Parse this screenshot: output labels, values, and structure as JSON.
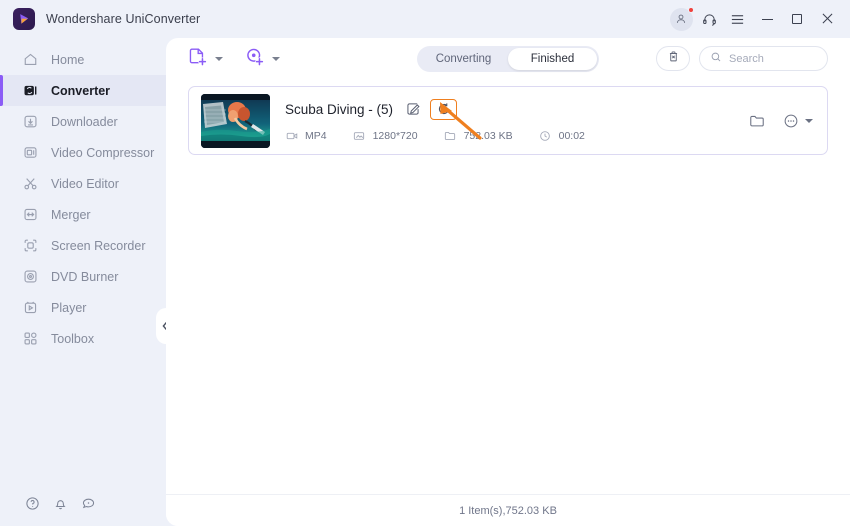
{
  "window": {
    "app_title": "Wondershare UniConverter",
    "logo_icon": "uniconverter-logo-icon",
    "controls": {
      "account_icon": "account-avatar-icon",
      "support_icon": "headset-support-icon",
      "menu_icon": "hamburger-menu-icon",
      "minimize_icon": "minimize-icon",
      "maximize_icon": "maximize-icon",
      "close_icon": "close-icon"
    }
  },
  "sidebar": {
    "items": [
      {
        "label": "Home",
        "icon": "home-icon",
        "active": false
      },
      {
        "label": "Converter",
        "icon": "converter-icon",
        "active": true
      },
      {
        "label": "Downloader",
        "icon": "download-icon",
        "active": false
      },
      {
        "label": "Video Compressor",
        "icon": "compressor-icon",
        "active": false
      },
      {
        "label": "Video Editor",
        "icon": "scissors-icon",
        "active": false
      },
      {
        "label": "Merger",
        "icon": "merger-icon",
        "active": false
      },
      {
        "label": "Screen Recorder",
        "icon": "screen-recorder-icon",
        "active": false
      },
      {
        "label": "DVD Burner",
        "icon": "disc-icon",
        "active": false
      },
      {
        "label": "Player",
        "icon": "player-icon",
        "active": false
      },
      {
        "label": "Toolbox",
        "icon": "toolbox-icon",
        "active": false
      }
    ],
    "collapse_icon": "chevron-left-icon",
    "bottom_icons": [
      {
        "icon": "help-icon"
      },
      {
        "icon": "bell-notification-icon"
      },
      {
        "icon": "feedback-icon"
      }
    ]
  },
  "toolbar": {
    "add_file_icon": "add-file-icon",
    "add_file_dropdown_icon": "chevron-down-icon",
    "add_disc_icon": "add-disc-icon",
    "add_disc_dropdown_icon": "chevron-down-icon",
    "tabs": [
      {
        "label": "Converting",
        "active": false
      },
      {
        "label": "Finished",
        "active": true
      }
    ],
    "delete_icon": "trash-icon",
    "search": {
      "icon": "search-icon",
      "value": "",
      "placeholder": "Search"
    }
  },
  "file_list": {
    "items": [
      {
        "name": "Scuba Diving - (5)",
        "thumbnail_icon": "video-thumbnail-scuba-diving",
        "edit_icon": "edit-icon",
        "reconvert_icon": "reconvert-refresh-icon",
        "highlighted": true,
        "format": "MP4",
        "format_icon": "video-format-icon",
        "resolution": "1280*720",
        "resolution_icon": "resolution-icon",
        "size": "752.03 KB",
        "size_icon": "folder-size-icon",
        "duration": "00:02",
        "duration_icon": "clock-icon",
        "open_folder_icon": "folder-icon",
        "more_icon": "more-options-icon",
        "more_dropdown_icon": "chevron-down-icon"
      }
    ]
  },
  "annotation": {
    "highlight_color": "#ef7f1f",
    "arrow_icon": "pointer-arrow-icon"
  },
  "footer": {
    "status": "1 Item(s),752.03 KB"
  }
}
